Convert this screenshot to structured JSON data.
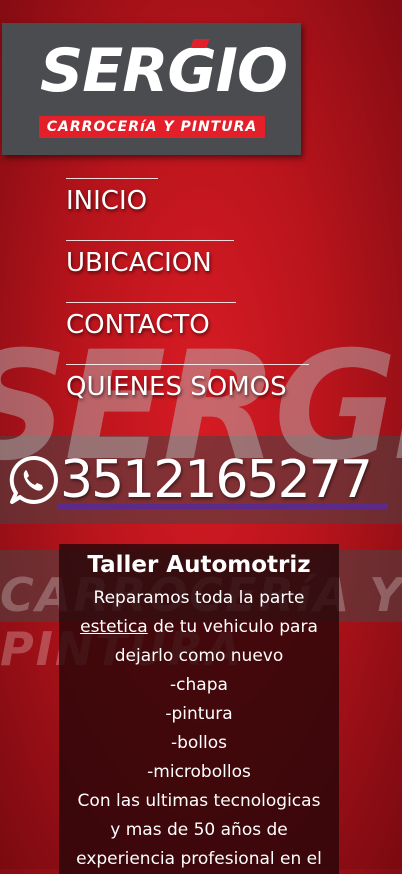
{
  "brand": {
    "name": "SERGIO",
    "tagline": "CARROCERíA Y PINTURA"
  },
  "nav": {
    "items": [
      {
        "label": "INICIO"
      },
      {
        "label": "UBICACION"
      },
      {
        "label": "CONTACTO"
      },
      {
        "label": "QUIENES SOMOS"
      }
    ]
  },
  "contact": {
    "icon": "whatsapp-icon",
    "phone": "3512165277"
  },
  "info": {
    "title": "Taller Automotriz",
    "line1": "Reparamos toda la parte",
    "line2_underlined": "estetica",
    "line2_rest": " de tu vehiculo para",
    "line3": "dejarlo como nuevo",
    "services": [
      "-chapa",
      "-pintura",
      "-bollos",
      "-microbollos"
    ],
    "closing1": "Con las ultimas tecnologicas",
    "closing2": "y mas de 50 años de",
    "closing3": "experiencia profesional en el"
  },
  "colors": {
    "background_red": "#c8161f",
    "logo_gray": "#4b4c4f",
    "accent_red": "#e3202a",
    "phone_underline": "#5b2a8a"
  }
}
